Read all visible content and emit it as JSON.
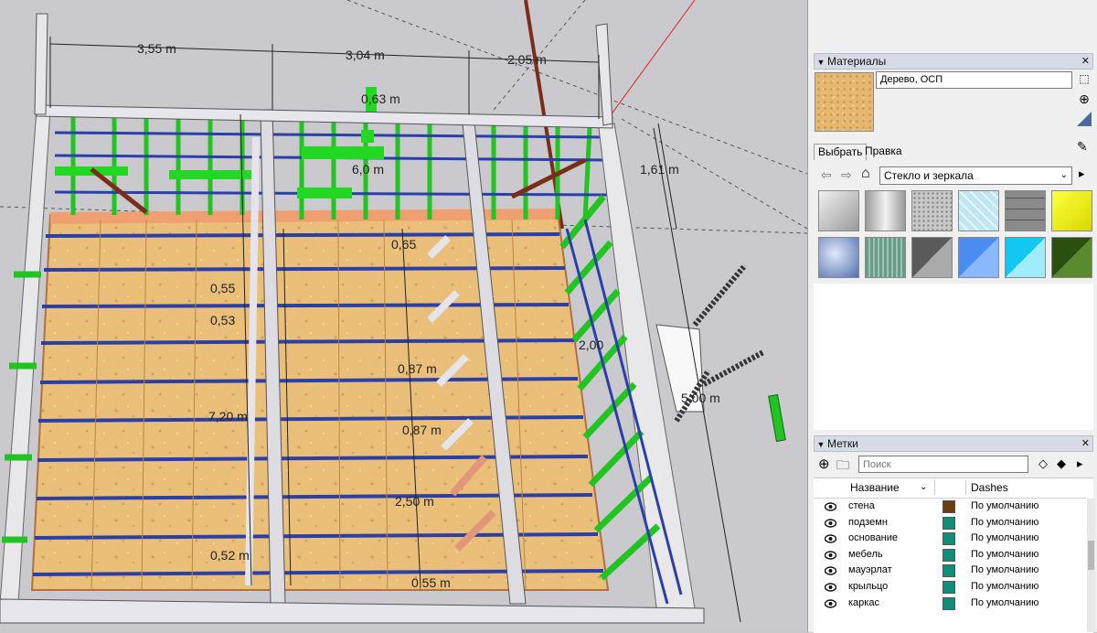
{
  "viewport": {
    "dimension_labels": [
      {
        "id": "dim-3-55",
        "text": "3,55 m"
      },
      {
        "id": "dim-3-04",
        "text": "3,04 m"
      },
      {
        "id": "dim-2-05",
        "text": "2,05 m"
      },
      {
        "id": "dim-1-61",
        "text": "1,61 m"
      },
      {
        "id": "dim-0-63",
        "text": "0,63 m"
      },
      {
        "id": "dim-6-0",
        "text": "6,0 m"
      },
      {
        "id": "dim-7-20",
        "text": "7,20 m"
      },
      {
        "id": "dim-0-87a",
        "text": "0,87 m"
      },
      {
        "id": "dim-0-87b",
        "text": "0,87 m"
      },
      {
        "id": "dim-2-50",
        "text": "2,50 m"
      },
      {
        "id": "dim-0-55a",
        "text": "0,55"
      },
      {
        "id": "dim-0-53",
        "text": "0,53"
      },
      {
        "id": "dim-0-65",
        "text": "0,65"
      },
      {
        "id": "dim-0-52",
        "text": "0,52 m"
      },
      {
        "id": "dim-0-55b",
        "text": "0,55 m"
      },
      {
        "id": "dim-5-00",
        "text": "5,00 m"
      },
      {
        "id": "dim-2-00",
        "text": "2,00"
      }
    ]
  },
  "materials_panel": {
    "title": "Материалы",
    "material_name": "Дерево, ОСП",
    "tabs": [
      "Выбрать",
      "Правка"
    ],
    "library_selected": "Стекло и зеркала",
    "swatch_colors": [
      "#b8b8b8",
      "#d8d8d8",
      "#c8c8c8",
      "#bfe6f5",
      "#8a8a8a",
      "#f5f500",
      "#7090c8",
      "#6a9a88",
      "#8c8c8c",
      "#4a8cf0",
      "#12c8f0",
      "#3a6a18"
    ]
  },
  "tags_panel": {
    "title": "Метки",
    "search_placeholder": "Поиск",
    "col_name": "Название",
    "col_dashes": "Dashes",
    "rows": [
      {
        "name": "стена",
        "color": "#6b3e10",
        "dashes": "По умолчанию"
      },
      {
        "name": "подземн",
        "color": "#0f8f7a",
        "dashes": "По умолчанию"
      },
      {
        "name": "основание",
        "color": "#0f8f7a",
        "dashes": "По умолчанию"
      },
      {
        "name": "мебель",
        "color": "#0f8f7a",
        "dashes": "По умолчанию"
      },
      {
        "name": "мауэрлат",
        "color": "#0f8f7a",
        "dashes": "По умолчанию"
      },
      {
        "name": "крыльцо",
        "color": "#0f8f7a",
        "dashes": "По умолчанию"
      },
      {
        "name": "каркас",
        "color": "#0f8f7a",
        "dashes": "По умолчанию"
      }
    ]
  }
}
